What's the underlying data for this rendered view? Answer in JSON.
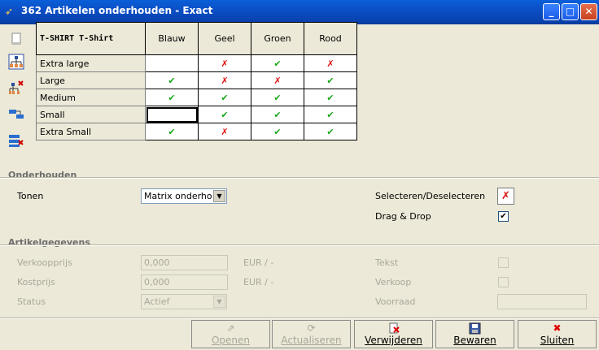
{
  "window": {
    "title": "362 Artikelen onderhouden - Exact",
    "minimize": "_",
    "maximize": "□",
    "close": "✕"
  },
  "matrix": {
    "corner_label": "T-SHIRT  T-Shirt",
    "columns": [
      "Blauw",
      "Geel",
      "Groen",
      "Rood"
    ],
    "rows": [
      {
        "label": "Extra large",
        "cells": [
          "",
          "✗",
          "✔",
          "✗"
        ]
      },
      {
        "label": "Large",
        "cells": [
          "✔",
          "✗",
          "✗",
          "✔"
        ]
      },
      {
        "label": "Medium",
        "cells": [
          "✔",
          "✔",
          "✔",
          "✔"
        ]
      },
      {
        "label": "Small",
        "cells": [
          "",
          "✔",
          "✔",
          "✔"
        ]
      },
      {
        "label": "Extra Small",
        "cells": [
          "✔",
          "✗",
          "✔",
          "✔"
        ]
      }
    ]
  },
  "onderhouden": {
    "title": "Onderhouden",
    "tonen_label": "Tonen",
    "tonen_value": "Matrix onderho",
    "select_label": "Selecteren/Deselecteren",
    "select_icon": "✗",
    "dragdrop_label": "Drag & Drop",
    "dragdrop_checked": "✔"
  },
  "artikelgegevens": {
    "title": "Artikelgegevens",
    "verkoopprijs_label": "Verkoopprijs",
    "verkoopprijs_value": "0,000",
    "verkoopprijs_unit": "EUR / -",
    "kostprijs_label": "Kostprijs",
    "kostprijs_value": "0,000",
    "kostprijs_unit": "EUR / -",
    "status_label": "Status",
    "status_value": "Actief",
    "tekst_label": "Tekst",
    "verkoop_label": "Verkoop",
    "voorraad_label": "Voorraad"
  },
  "buttons": {
    "openen": "Openen",
    "actualiseren": "Actualiseren",
    "verwijderen": "Verwijderen",
    "bewaren": "Bewaren",
    "sluiten": "Sluiten"
  },
  "colors": {
    "titlebar": "#0b4fc6",
    "check": "#18a818",
    "cross": "#e01010",
    "face": "#ece9d8"
  }
}
